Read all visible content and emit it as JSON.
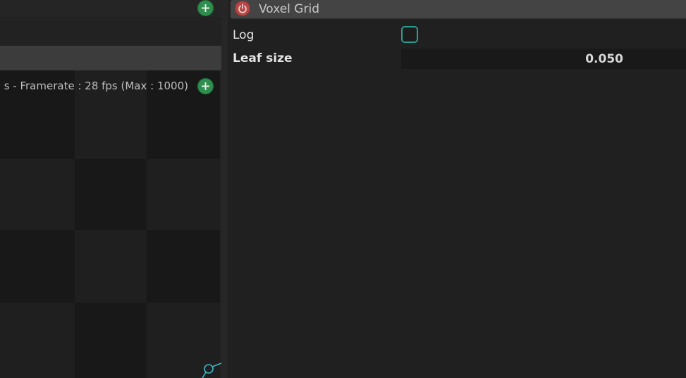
{
  "left_panel": {
    "status_text": "s - Framerate : 28 fps (Max : 1000)",
    "icons": {
      "add_top": "plus-circle-icon",
      "add_view": "plus-circle-icon",
      "gizmo": "axis-gizmo-icon"
    }
  },
  "filter": {
    "title": "Voxel Grid",
    "power_icon": "power-icon",
    "properties": {
      "log_label": "Log",
      "log_checked": false,
      "leaf_size_label": "Leaf size",
      "leaf_size_value": "0.050"
    }
  },
  "colors": {
    "accent_green": "#2f8e4e",
    "power_red": "#b64747",
    "checkbox_teal": "#2a9d8f",
    "gizmo_cyan": "#3fb6c4"
  }
}
